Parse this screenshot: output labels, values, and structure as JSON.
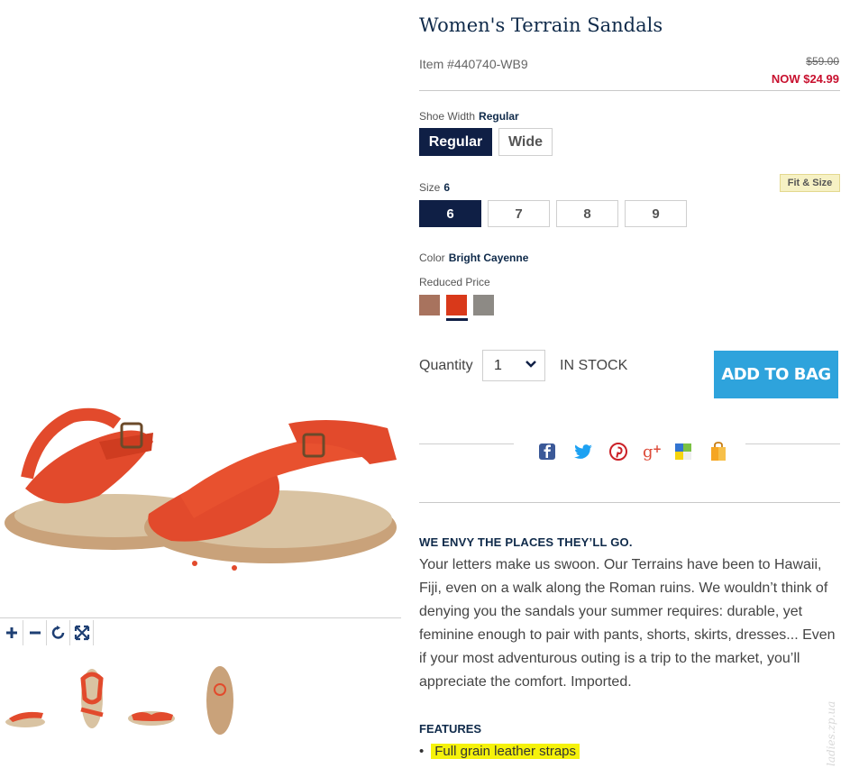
{
  "product": {
    "title": "Women's Terrain Sandals",
    "item_number": "Item #440740-WB9",
    "price_was": "$59.00",
    "price_now": "NOW $24.99"
  },
  "shoe_width": {
    "label": "Shoe Width",
    "selected": "Regular",
    "options": [
      "Regular",
      "Wide"
    ]
  },
  "size": {
    "label": "Size",
    "selected": "6",
    "options": [
      "6",
      "7",
      "8",
      "9"
    ],
    "fit_link": "Fit & Size"
  },
  "color": {
    "label": "Color",
    "selected": "Bright Cayenne",
    "sub_label": "Reduced Price",
    "swatches": [
      {
        "name": "tan-swatch",
        "color": "#a8735e"
      },
      {
        "name": "bright-cayenne-swatch",
        "color": "#d9391a"
      },
      {
        "name": "gray-swatch",
        "color": "#8d8a85"
      }
    ]
  },
  "purchase": {
    "quantity_label": "Quantity",
    "quantity_value": "1",
    "stock_status": "IN STOCK",
    "add_to_bag": "ADD TO BAG"
  },
  "share_icons": [
    "facebook-icon",
    "twitter-icon",
    "pinterest-icon",
    "google-plus-icon",
    "delicious-icon",
    "shopping-bag-icon"
  ],
  "image_controls": [
    "zoom-in-icon",
    "zoom-out-icon",
    "rotate-icon",
    "fullscreen-icon"
  ],
  "description": {
    "heading": "WE ENVY THE PLACES THEY’LL GO.",
    "body": "Your letters make us swoon. Our Terrains have been to Hawaii, Fiji, even on a walk along the Roman ruins. We wouldn’t think of denying you the sandals your summer requires: durable, yet feminine enough to pair with pants, shorts, skirts, dresses... Even if your most adventurous outing is a trip to the market, you’ll appreciate the comfort. Imported."
  },
  "features": {
    "heading": "FEATURES",
    "items": [
      "Full grain leather straps"
    ]
  },
  "watermark": "ladies.zp.ua",
  "colors": {
    "navy": "#0f1f45",
    "accent_blue": "#2ea3dc",
    "sale_red": "#c8102e",
    "highlight": "#f5f20a"
  }
}
